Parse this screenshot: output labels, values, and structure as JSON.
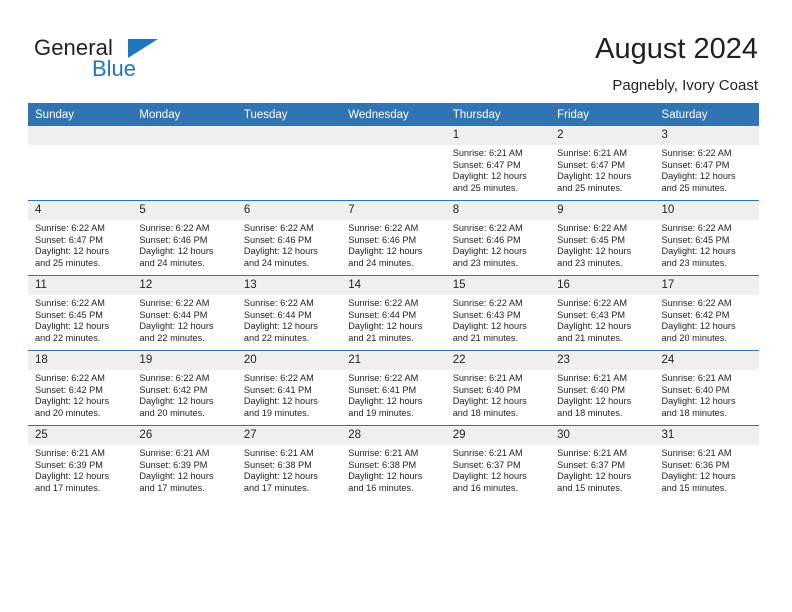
{
  "brand": {
    "name_part1": "General",
    "name_part2": "Blue",
    "triangle_color": "#1f76bc",
    "text_color": "#231f20"
  },
  "header": {
    "title": "August 2024",
    "subtitle": "Pagnebly, Ivory Coast",
    "accent_color": "#3174b4"
  },
  "calendar": {
    "weekday_headers": [
      "Sunday",
      "Monday",
      "Tuesday",
      "Wednesday",
      "Thursday",
      "Friday",
      "Saturday"
    ],
    "weeks": [
      [
        {
          "day": "",
          "sunrise": "",
          "sunset": "",
          "daylight_line1": "",
          "daylight_line2": ""
        },
        {
          "day": "",
          "sunrise": "",
          "sunset": "",
          "daylight_line1": "",
          "daylight_line2": ""
        },
        {
          "day": "",
          "sunrise": "",
          "sunset": "",
          "daylight_line1": "",
          "daylight_line2": ""
        },
        {
          "day": "",
          "sunrise": "",
          "sunset": "",
          "daylight_line1": "",
          "daylight_line2": ""
        },
        {
          "day": "1",
          "sunrise": "Sunrise: 6:21 AM",
          "sunset": "Sunset: 6:47 PM",
          "daylight_line1": "Daylight: 12 hours",
          "daylight_line2": "and 25 minutes."
        },
        {
          "day": "2",
          "sunrise": "Sunrise: 6:21 AM",
          "sunset": "Sunset: 6:47 PM",
          "daylight_line1": "Daylight: 12 hours",
          "daylight_line2": "and 25 minutes."
        },
        {
          "day": "3",
          "sunrise": "Sunrise: 6:22 AM",
          "sunset": "Sunset: 6:47 PM",
          "daylight_line1": "Daylight: 12 hours",
          "daylight_line2": "and 25 minutes."
        }
      ],
      [
        {
          "day": "4",
          "sunrise": "Sunrise: 6:22 AM",
          "sunset": "Sunset: 6:47 PM",
          "daylight_line1": "Daylight: 12 hours",
          "daylight_line2": "and 25 minutes."
        },
        {
          "day": "5",
          "sunrise": "Sunrise: 6:22 AM",
          "sunset": "Sunset: 6:46 PM",
          "daylight_line1": "Daylight: 12 hours",
          "daylight_line2": "and 24 minutes."
        },
        {
          "day": "6",
          "sunrise": "Sunrise: 6:22 AM",
          "sunset": "Sunset: 6:46 PM",
          "daylight_line1": "Daylight: 12 hours",
          "daylight_line2": "and 24 minutes."
        },
        {
          "day": "7",
          "sunrise": "Sunrise: 6:22 AM",
          "sunset": "Sunset: 6:46 PM",
          "daylight_line1": "Daylight: 12 hours",
          "daylight_line2": "and 24 minutes."
        },
        {
          "day": "8",
          "sunrise": "Sunrise: 6:22 AM",
          "sunset": "Sunset: 6:46 PM",
          "daylight_line1": "Daylight: 12 hours",
          "daylight_line2": "and 23 minutes."
        },
        {
          "day": "9",
          "sunrise": "Sunrise: 6:22 AM",
          "sunset": "Sunset: 6:45 PM",
          "daylight_line1": "Daylight: 12 hours",
          "daylight_line2": "and 23 minutes."
        },
        {
          "day": "10",
          "sunrise": "Sunrise: 6:22 AM",
          "sunset": "Sunset: 6:45 PM",
          "daylight_line1": "Daylight: 12 hours",
          "daylight_line2": "and 23 minutes."
        }
      ],
      [
        {
          "day": "11",
          "sunrise": "Sunrise: 6:22 AM",
          "sunset": "Sunset: 6:45 PM",
          "daylight_line1": "Daylight: 12 hours",
          "daylight_line2": "and 22 minutes."
        },
        {
          "day": "12",
          "sunrise": "Sunrise: 6:22 AM",
          "sunset": "Sunset: 6:44 PM",
          "daylight_line1": "Daylight: 12 hours",
          "daylight_line2": "and 22 minutes."
        },
        {
          "day": "13",
          "sunrise": "Sunrise: 6:22 AM",
          "sunset": "Sunset: 6:44 PM",
          "daylight_line1": "Daylight: 12 hours",
          "daylight_line2": "and 22 minutes."
        },
        {
          "day": "14",
          "sunrise": "Sunrise: 6:22 AM",
          "sunset": "Sunset: 6:44 PM",
          "daylight_line1": "Daylight: 12 hours",
          "daylight_line2": "and 21 minutes."
        },
        {
          "day": "15",
          "sunrise": "Sunrise: 6:22 AM",
          "sunset": "Sunset: 6:43 PM",
          "daylight_line1": "Daylight: 12 hours",
          "daylight_line2": "and 21 minutes."
        },
        {
          "day": "16",
          "sunrise": "Sunrise: 6:22 AM",
          "sunset": "Sunset: 6:43 PM",
          "daylight_line1": "Daylight: 12 hours",
          "daylight_line2": "and 21 minutes."
        },
        {
          "day": "17",
          "sunrise": "Sunrise: 6:22 AM",
          "sunset": "Sunset: 6:42 PM",
          "daylight_line1": "Daylight: 12 hours",
          "daylight_line2": "and 20 minutes."
        }
      ],
      [
        {
          "day": "18",
          "sunrise": "Sunrise: 6:22 AM",
          "sunset": "Sunset: 6:42 PM",
          "daylight_line1": "Daylight: 12 hours",
          "daylight_line2": "and 20 minutes."
        },
        {
          "day": "19",
          "sunrise": "Sunrise: 6:22 AM",
          "sunset": "Sunset: 6:42 PM",
          "daylight_line1": "Daylight: 12 hours",
          "daylight_line2": "and 20 minutes."
        },
        {
          "day": "20",
          "sunrise": "Sunrise: 6:22 AM",
          "sunset": "Sunset: 6:41 PM",
          "daylight_line1": "Daylight: 12 hours",
          "daylight_line2": "and 19 minutes."
        },
        {
          "day": "21",
          "sunrise": "Sunrise: 6:22 AM",
          "sunset": "Sunset: 6:41 PM",
          "daylight_line1": "Daylight: 12 hours",
          "daylight_line2": "and 19 minutes."
        },
        {
          "day": "22",
          "sunrise": "Sunrise: 6:21 AM",
          "sunset": "Sunset: 6:40 PM",
          "daylight_line1": "Daylight: 12 hours",
          "daylight_line2": "and 18 minutes."
        },
        {
          "day": "23",
          "sunrise": "Sunrise: 6:21 AM",
          "sunset": "Sunset: 6:40 PM",
          "daylight_line1": "Daylight: 12 hours",
          "daylight_line2": "and 18 minutes."
        },
        {
          "day": "24",
          "sunrise": "Sunrise: 6:21 AM",
          "sunset": "Sunset: 6:40 PM",
          "daylight_line1": "Daylight: 12 hours",
          "daylight_line2": "and 18 minutes."
        }
      ],
      [
        {
          "day": "25",
          "sunrise": "Sunrise: 6:21 AM",
          "sunset": "Sunset: 6:39 PM",
          "daylight_line1": "Daylight: 12 hours",
          "daylight_line2": "and 17 minutes."
        },
        {
          "day": "26",
          "sunrise": "Sunrise: 6:21 AM",
          "sunset": "Sunset: 6:39 PM",
          "daylight_line1": "Daylight: 12 hours",
          "daylight_line2": "and 17 minutes."
        },
        {
          "day": "27",
          "sunrise": "Sunrise: 6:21 AM",
          "sunset": "Sunset: 6:38 PM",
          "daylight_line1": "Daylight: 12 hours",
          "daylight_line2": "and 17 minutes."
        },
        {
          "day": "28",
          "sunrise": "Sunrise: 6:21 AM",
          "sunset": "Sunset: 6:38 PM",
          "daylight_line1": "Daylight: 12 hours",
          "daylight_line2": "and 16 minutes."
        },
        {
          "day": "29",
          "sunrise": "Sunrise: 6:21 AM",
          "sunset": "Sunset: 6:37 PM",
          "daylight_line1": "Daylight: 12 hours",
          "daylight_line2": "and 16 minutes."
        },
        {
          "day": "30",
          "sunrise": "Sunrise: 6:21 AM",
          "sunset": "Sunset: 6:37 PM",
          "daylight_line1": "Daylight: 12 hours",
          "daylight_line2": "and 15 minutes."
        },
        {
          "day": "31",
          "sunrise": "Sunrise: 6:21 AM",
          "sunset": "Sunset: 6:36 PM",
          "daylight_line1": "Daylight: 12 hours",
          "daylight_line2": "and 15 minutes."
        }
      ]
    ]
  }
}
